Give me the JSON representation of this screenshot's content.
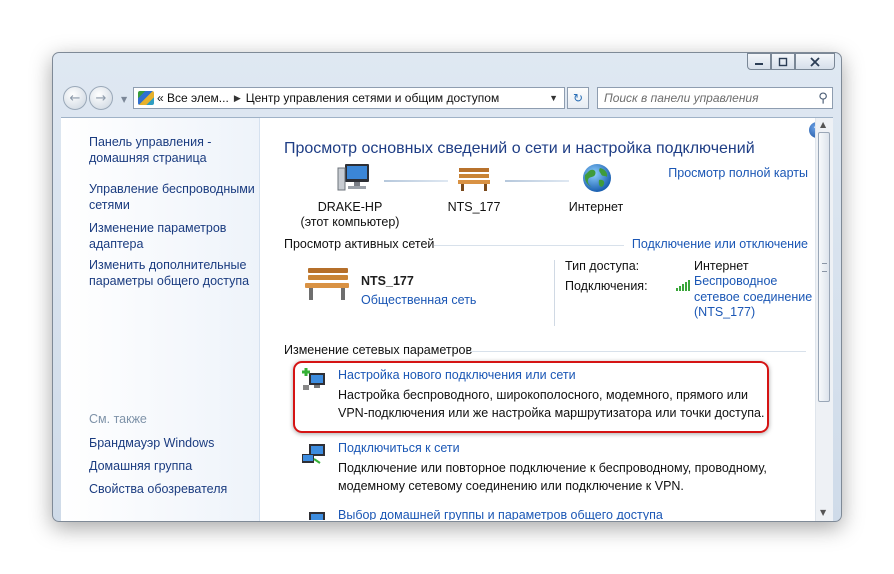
{
  "address_bar": {
    "segments": [
      "« Все элем...",
      "Центр управления сетями и общим доступом"
    ]
  },
  "search": {
    "placeholder": "Поиск в панели управления"
  },
  "sidebar": {
    "items": [
      {
        "label": "Панель управления - домашняя страница"
      },
      {
        "label": "Управление беспроводными сетями"
      },
      {
        "label": "Изменение параметров адаптера"
      },
      {
        "label": "Изменить дополнительные параметры общего доступа"
      }
    ],
    "see_also_title": "См. также",
    "see_also": [
      {
        "label": "Брандмауэр Windows"
      },
      {
        "label": "Домашняя группа"
      },
      {
        "label": "Свойства обозревателя"
      }
    ]
  },
  "main": {
    "title": "Просмотр основных сведений о сети и настройка подключений",
    "map_link": "Просмотр полной карты",
    "nodes": [
      {
        "name": "DRAKE-HP",
        "sub": "(этот компьютер)"
      },
      {
        "name": "NTS_177"
      },
      {
        "name": "Интернет"
      }
    ],
    "active_section": {
      "title": "Просмотр активных сетей",
      "link": "Подключение или отключение",
      "network_name": "NTS_177",
      "network_category": "Общественная сеть",
      "access_type_label": "Тип доступа:",
      "access_type_value": "Интернет",
      "connections_label": "Подключения:",
      "connection_value": "Беспроводное сетевое соединение (NTS_177)"
    },
    "change_section": {
      "title": "Изменение сетевых параметров",
      "tasks": [
        {
          "title": "Настройка нового подключения или сети",
          "desc": "Настройка беспроводного, широкополосного, модемного, прямого или VPN-подключения или же настройка маршрутизатора или точки доступа."
        },
        {
          "title": "Подключиться к сети",
          "desc": "Подключение или повторное подключение к беспроводному, проводному, модемному сетевому соединению или подключение к VPN."
        },
        {
          "title": "Выбор домашней группы и параметров общего доступа"
        }
      ]
    }
  },
  "colors": {
    "link": "#1b57b5",
    "highlight": "#d51414",
    "title": "#1e3d85"
  }
}
